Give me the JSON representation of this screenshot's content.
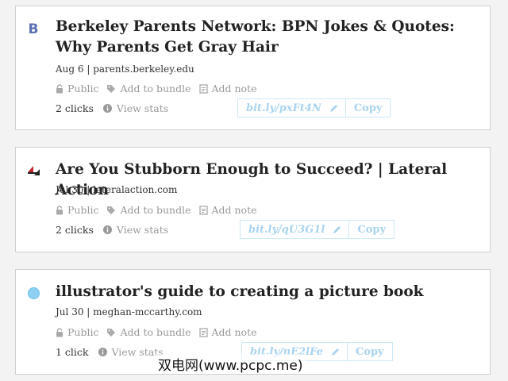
{
  "bookmarks": [
    {
      "title": "Berkeley Parents Network: BPN Jokes & Quotes: Why Parents Get Gray Hair",
      "meta": "Aug 6 | parents.berkeley.edu",
      "favicon": "letter-b-icon",
      "privacy_label": "Public",
      "bundle_label": "Add to bundle",
      "note_label": "Add note",
      "clicks": "2 clicks",
      "stats_label": "View stats",
      "short_link": "bit.ly/pxFt4N",
      "copy_label": "Copy"
    },
    {
      "title": "Are You Stubborn Enough to Succeed? | Lateral Action",
      "meta": "Jul 30 | lateralaction.com",
      "favicon": "lateral-action-logo-icon",
      "privacy_label": "Public",
      "bundle_label": "Add to bundle",
      "note_label": "Add note",
      "clicks": "2 clicks",
      "stats_label": "View stats",
      "short_link": "bit.ly/qU3G1l",
      "copy_label": "Copy"
    },
    {
      "title": "illustrator's guide to creating a picture book",
      "meta": "Jul 30 | meghan-mccarthy.com",
      "favicon": "blue-circle-icon",
      "privacy_label": "Public",
      "bundle_label": "Add to bundle",
      "note_label": "Add note",
      "clicks": "1 click",
      "stats_label": "View stats",
      "short_link": "bit.ly/nE2lFe",
      "copy_label": "Copy"
    }
  ],
  "watermark": "双电网(www.pcpc.me)",
  "colors": {
    "background": "#f3f3f3",
    "card_border": "#cfcfcf",
    "link_blue": "#a9d3ef",
    "muted_gray": "#999999"
  }
}
